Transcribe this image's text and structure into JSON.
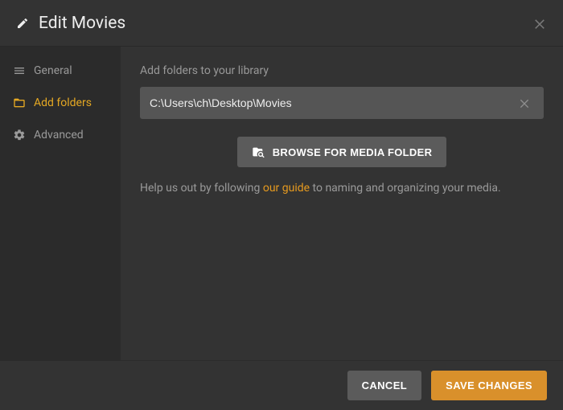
{
  "header": {
    "title": "Edit Movies"
  },
  "sidebar": {
    "items": [
      {
        "label": "General"
      },
      {
        "label": "Add folders"
      },
      {
        "label": "Advanced"
      }
    ]
  },
  "main": {
    "section_title": "Add folders to your library",
    "folder_path": "C:\\Users\\ch\\Desktop\\Movies",
    "browse_label": "BROWSE FOR MEDIA FOLDER",
    "help_prefix": "Help us out by following ",
    "help_link": "our guide",
    "help_suffix": " to naming and organizing your media."
  },
  "footer": {
    "cancel_label": "CANCEL",
    "save_label": "SAVE CHANGES"
  },
  "colors": {
    "accent": "#e6a923",
    "save": "#d9902b"
  }
}
